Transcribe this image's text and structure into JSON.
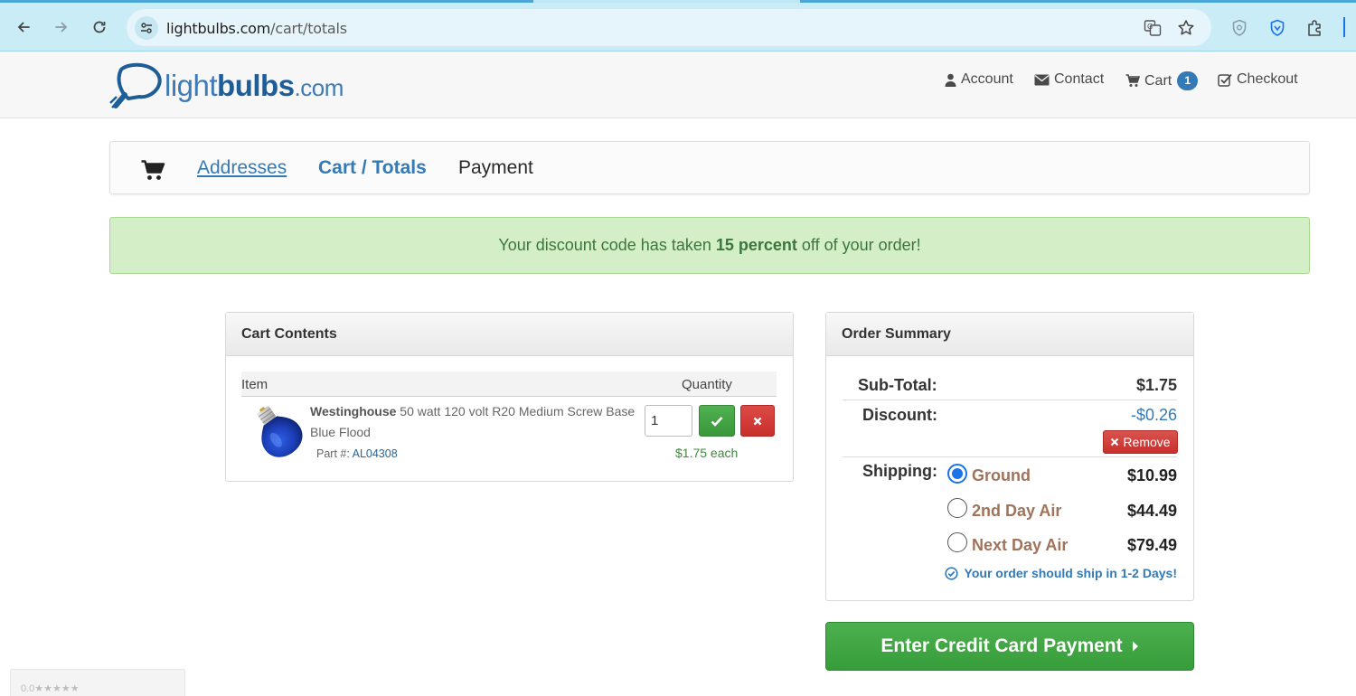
{
  "browser": {
    "url_host": "lightbulbs.com",
    "url_path": "/cart/totals"
  },
  "header": {
    "logo_light": "light",
    "logo_bulbs": "bulbs",
    "logo_com": ".com",
    "nav": {
      "account": "Account",
      "contact": "Contact",
      "cart": "Cart",
      "cart_count": "1",
      "checkout": "Checkout"
    }
  },
  "steps": {
    "addresses": "Addresses",
    "cart_totals": "Cart / Totals",
    "payment": "Payment"
  },
  "alert": {
    "before": "Your discount code has taken ",
    "strong": "15 percent",
    "after": " off of your order!"
  },
  "cart": {
    "heading": "Cart Contents",
    "col_item": "Item",
    "col_quantity": "Quantity",
    "item": {
      "brand": "Westinghouse",
      "description": " 50 watt 120 volt R20 Medium Screw Base Blue Flood",
      "part_label": "Part #: ",
      "part_number": "AL04308",
      "quantity": "1",
      "each_price": "$1.75 each"
    }
  },
  "summary": {
    "heading": "Order Summary",
    "subtotal_label": "Sub-Total:",
    "subtotal_value": "$1.75",
    "discount_label": "Discount:",
    "discount_value": "-$0.26",
    "remove_label": "Remove",
    "shipping_label": "Shipping:",
    "shipping_options": [
      {
        "name": "Ground",
        "price": "$10.99",
        "selected": true
      },
      {
        "name": "2nd Day Air",
        "price": "$44.49",
        "selected": false
      },
      {
        "name": "Next Day Air",
        "price": "$79.49",
        "selected": false
      }
    ],
    "ship_note": "Your order should ship in 1-2 Days!"
  },
  "payment_button": "Enter Credit Card Payment",
  "rating_widget": "0.0★★★★★",
  "colors": {
    "brand_blue": "#337ab7",
    "success_green": "#4cb04f",
    "danger_red": "#d9534f",
    "alert_bg": "#d4eec8",
    "shipping_name": "#a0735b"
  }
}
